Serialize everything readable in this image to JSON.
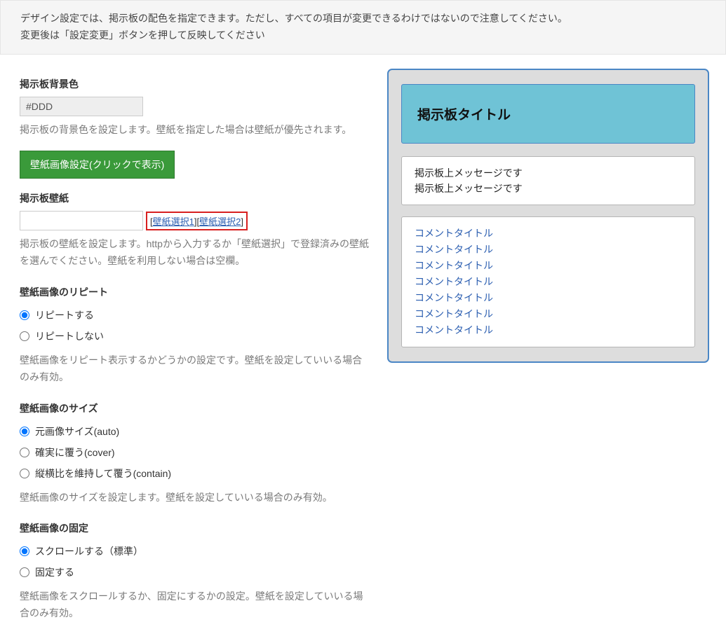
{
  "info": {
    "line1": "デザイン設定では、掲示板の配色を指定できます。ただし、すべての項目が変更できるわけではないので注意してください。",
    "line2": "変更後は「設定変更」ボタンを押して反映してください"
  },
  "bgcolor": {
    "label": "掲示板背景色",
    "value": "#DDD",
    "help": "掲示板の背景色を設定します。壁紙を指定した場合は壁紙が優先されます。"
  },
  "wallpaper_btn": "壁紙画像設定(クリックで表示)",
  "wallpaper": {
    "label": "掲示板壁紙",
    "value": "",
    "link1": "壁紙選択1",
    "link2": "壁紙選択2",
    "help": "掲示板の壁紙を設定します。httpから入力するか「壁紙選択」で登録済みの壁紙を選んでください。壁紙を利用しない場合は空欄。"
  },
  "repeat": {
    "label": "壁紙画像のリピート",
    "opt1": "リピートする",
    "opt2": "リピートしない",
    "help": "壁紙画像をリピート表示するかどうかの設定です。壁紙を設定していいる場合のみ有効。"
  },
  "size": {
    "label": "壁紙画像のサイズ",
    "opt1": "元画像サイズ(auto)",
    "opt2": "確実に覆う(cover)",
    "opt3": "縦横比を維持して覆う(contain)",
    "help": "壁紙画像のサイズを設定します。壁紙を設定していいる場合のみ有効。"
  },
  "attach": {
    "label": "壁紙画像の固定",
    "opt1": "スクロールする（標準）",
    "opt2": "固定する",
    "help": "壁紙画像をスクロールするか、固定にするかの設定。壁紙を設定していいる場合のみ有効。"
  },
  "preview": {
    "title": "掲示板タイトル",
    "msg1": "掲示板上メッセージです",
    "msg2": "掲示板上メッセージです",
    "comment": "コメントタイトル"
  }
}
